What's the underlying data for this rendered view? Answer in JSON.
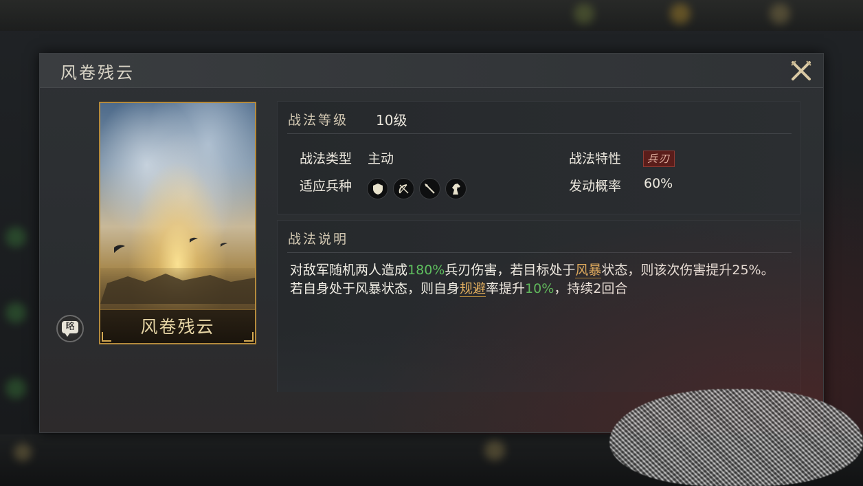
{
  "dialog": {
    "title": "风卷残云"
  },
  "card": {
    "name": "风卷残云",
    "badge_label": "略"
  },
  "tactic": {
    "level_label": "战法等级",
    "level_value": "10级",
    "type_label": "战法类型",
    "type_value": "主动",
    "trait_label": "战法特性",
    "trait_value": "兵刃",
    "units_label": "适应兵种",
    "units": [
      "shield-unit-icon",
      "bow-unit-icon",
      "spear-unit-icon",
      "horse-unit-icon"
    ],
    "trigger_label": "发动概率",
    "trigger_value": "60%"
  },
  "description": {
    "label": "战法说明",
    "line1_a": "对敌军随机两人造成",
    "line1_pct": "180%",
    "line1_b": "兵刃伤害，若目标处于",
    "line1_status": "风暴",
    "line1_c": "状态，则该次伤害提升25%。",
    "line2_a": "若自身处于风暴状态，则自身",
    "line2_term": "规避",
    "line2_b": "率提升",
    "line2_pct": "10%",
    "line2_c": "，持续2回合"
  },
  "colors": {
    "accent_gold": "#e2b060",
    "highlight_green": "#5fbf5f",
    "trait_red": "#5a1d1a"
  }
}
